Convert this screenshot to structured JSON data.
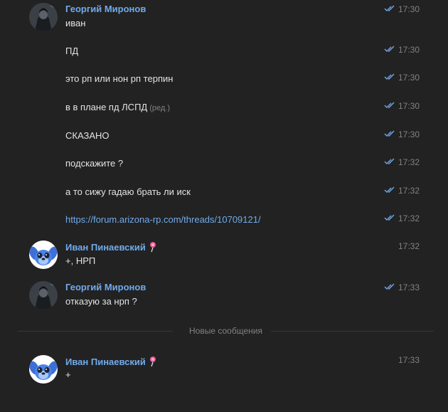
{
  "messages": [
    {
      "author": "Георгий Миронов",
      "text": "иван",
      "time": "17:30",
      "read": true
    },
    {
      "text": "ПД",
      "time": "17:30",
      "read": true
    },
    {
      "text": "это рп или нон рп терпин",
      "time": "17:30",
      "read": true
    },
    {
      "text": "в в плане пд ЛСПД",
      "edited": "(ред.)",
      "time": "17:30",
      "read": true
    },
    {
      "text": "СКАЗАНО",
      "time": "17:30",
      "read": true
    },
    {
      "text": "подскажите ?",
      "time": "17:32",
      "read": true
    },
    {
      "text": "а то сижу гадаю брать ли иск",
      "time": "17:32",
      "read": true
    },
    {
      "link": "https://forum.arizona-rp.com/threads/10709121/",
      "time": "17:32",
      "read": true
    },
    {
      "author": "Иван Пинаевский",
      "text": "+, НРП",
      "time": "17:32",
      "read": false
    },
    {
      "author": "Георгий Миронов",
      "text": "отказую за нрп ?",
      "time": "17:33",
      "read": true
    },
    {
      "author": "Иван Пинаевский",
      "text": "+",
      "time": "17:33",
      "read": false
    }
  ],
  "divider": {
    "label": "Новые сообщения"
  },
  "icons": {
    "read": "double-check-icon",
    "author_badge": "lollipop-icon"
  },
  "colors": {
    "background": "#222222",
    "author": "#71aaeb",
    "link": "#71aaeb",
    "text": "#e1e3e6",
    "muted": "#828282",
    "check": "#71aaeb"
  }
}
